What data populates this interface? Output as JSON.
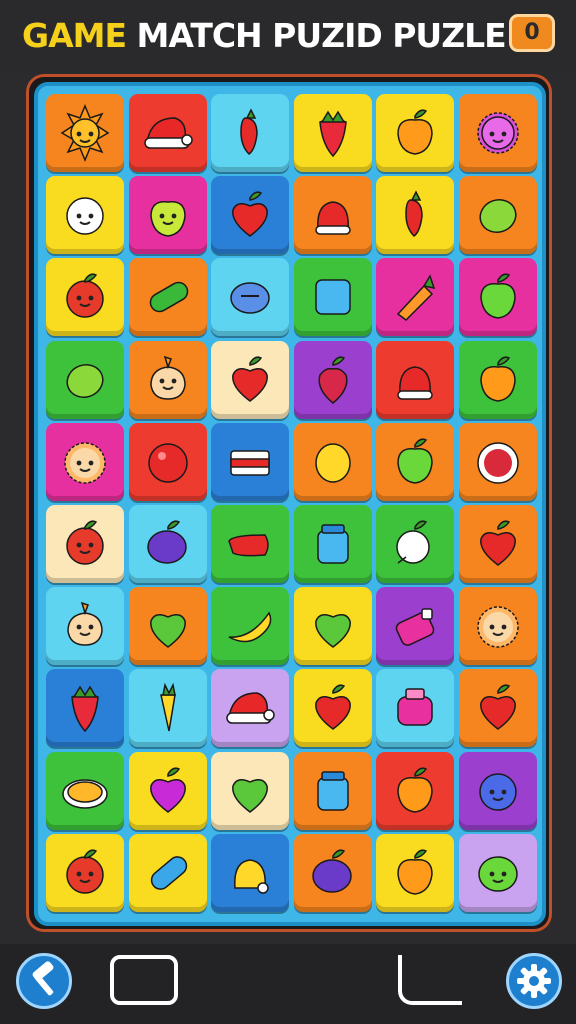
{
  "header": {
    "title_game": "GAME",
    "title_rest": " MATCH PUZID PUZLE",
    "score": "0"
  },
  "colors": {
    "red": "#ee3b2f",
    "orange": "#f6851f",
    "yellow": "#f9dc1f",
    "cyan": "#5fd4f0",
    "blue": "#2a7fd6",
    "green": "#3ec23c",
    "magenta": "#e7309f",
    "purple": "#9b3fcf",
    "cream": "#fbe7b8",
    "lavender": "#c9a3f0"
  },
  "board": {
    "rows": [
      [
        {
          "bg": "orange",
          "icon": "sun-icon"
        },
        {
          "bg": "red",
          "icon": "santa-hat-icon"
        },
        {
          "bg": "cyan",
          "icon": "chili-icon"
        },
        {
          "bg": "yellow",
          "icon": "strawberry-icon"
        },
        {
          "bg": "yellow",
          "icon": "orange-fruit-icon"
        },
        {
          "bg": "orange",
          "icon": "urchin-icon"
        }
      ],
      [
        {
          "bg": "yellow",
          "icon": "snowball-face-icon"
        },
        {
          "bg": "magenta",
          "icon": "apple-face-icon"
        },
        {
          "bg": "blue",
          "icon": "heart-apple-icon"
        },
        {
          "bg": "orange",
          "icon": "bell-icon"
        },
        {
          "bg": "yellow",
          "icon": "chili-icon"
        },
        {
          "bg": "orange",
          "icon": "lime-icon"
        }
      ],
      [
        {
          "bg": "yellow",
          "icon": "tomato-face-icon"
        },
        {
          "bg": "orange",
          "icon": "cucumber-icon"
        },
        {
          "bg": "cyan",
          "icon": "blueberry-icon"
        },
        {
          "bg": "green",
          "icon": "ice-cube-icon"
        },
        {
          "bg": "magenta",
          "icon": "carrot-icon"
        },
        {
          "bg": "magenta",
          "icon": "green-apple-icon"
        }
      ],
      [
        {
          "bg": "green",
          "icon": "lime-icon"
        },
        {
          "bg": "orange",
          "icon": "onion-face-icon"
        },
        {
          "bg": "cream",
          "icon": "heart-apple-icon"
        },
        {
          "bg": "purple",
          "icon": "radish-icon"
        },
        {
          "bg": "red",
          "icon": "bell-icon"
        },
        {
          "bg": "green",
          "icon": "orange-fruit-icon"
        }
      ],
      [
        {
          "bg": "magenta",
          "icon": "urchin-face-icon"
        },
        {
          "bg": "red",
          "icon": "red-ball-icon"
        },
        {
          "bg": "blue",
          "icon": "cake-icon"
        },
        {
          "bg": "orange",
          "icon": "lemon-icon"
        },
        {
          "bg": "orange",
          "icon": "green-apple-icon"
        },
        {
          "bg": "orange",
          "icon": "plate-icon"
        }
      ],
      [
        {
          "bg": "cream",
          "icon": "tomato-face-icon"
        },
        {
          "bg": "cyan",
          "icon": "eggplant-icon"
        },
        {
          "bg": "green",
          "icon": "red-pepper-icon"
        },
        {
          "bg": "green",
          "icon": "jar-icon"
        },
        {
          "bg": "green",
          "icon": "turnip-icon"
        },
        {
          "bg": "orange",
          "icon": "heart-apple-icon"
        }
      ],
      [
        {
          "bg": "cyan",
          "icon": "onion-face-icon"
        },
        {
          "bg": "orange",
          "icon": "green-heart-icon"
        },
        {
          "bg": "green",
          "icon": "banana-icon"
        },
        {
          "bg": "yellow",
          "icon": "green-heart-icon"
        },
        {
          "bg": "purple",
          "icon": "spray-icon"
        },
        {
          "bg": "orange",
          "icon": "urchin-face-icon"
        }
      ],
      [
        {
          "bg": "blue",
          "icon": "strawberry-icon"
        },
        {
          "bg": "cyan",
          "icon": "carrot-yellow-icon"
        },
        {
          "bg": "lavender",
          "icon": "santa-hat-icon"
        },
        {
          "bg": "yellow",
          "icon": "heart-apple-icon"
        },
        {
          "bg": "cyan",
          "icon": "jar-pink-icon"
        },
        {
          "bg": "orange",
          "icon": "heart-apple-icon"
        }
      ],
      [
        {
          "bg": "green",
          "icon": "pie-icon"
        },
        {
          "bg": "yellow",
          "icon": "purple-heart-icon"
        },
        {
          "bg": "cream",
          "icon": "green-heart-icon"
        },
        {
          "bg": "orange",
          "icon": "jar-icon"
        },
        {
          "bg": "red",
          "icon": "orange-fruit-icon"
        },
        {
          "bg": "purple",
          "icon": "blueberry-face-icon"
        }
      ],
      [
        {
          "bg": "yellow",
          "icon": "tomato-face-icon"
        },
        {
          "bg": "yellow",
          "icon": "cucumber-blue-icon"
        },
        {
          "bg": "blue",
          "icon": "bell-yellow-icon"
        },
        {
          "bg": "orange",
          "icon": "eggplant-icon"
        },
        {
          "bg": "yellow",
          "icon": "orange-fruit-icon"
        },
        {
          "bg": "lavender",
          "icon": "lime-face-icon"
        }
      ]
    ]
  },
  "footer": {
    "left_tool_icon": "hammer-icon",
    "right_tool_icon": "gear-icon"
  }
}
